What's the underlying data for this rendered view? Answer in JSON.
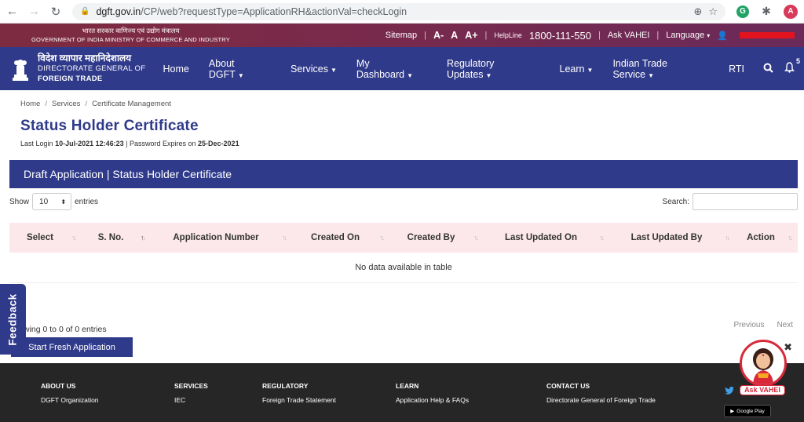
{
  "browser": {
    "url_host": "dgft.gov.in",
    "url_rest": "/CP/web?requestType=ApplicationRH&actionVal=checkLogin",
    "avatar_letter": "A",
    "ext_g_letter": "G"
  },
  "topbar": {
    "govt_hi": "भारत सरकार  वाणिज्य एवं उद्योग मंत्रालय",
    "govt_en": "GOVERNMENT OF INDIA   MINISTRY OF COMMERCE AND INDUSTRY",
    "sitemap": "Sitemap",
    "font_small": "A-",
    "font_normal": "A",
    "font_large": "A+",
    "helpline_label": "HelpLine",
    "phone": "1800-111-550",
    "ask_vahei": "Ask VAHEI",
    "language": "Language"
  },
  "logo": {
    "hi": "विदेश व्यापार महानिदेशालय",
    "line2": "DIRECTORATE GENERAL OF",
    "line3": "FOREIGN TRADE"
  },
  "nav": {
    "home": "Home",
    "about": "About DGFT",
    "services": "Services",
    "dashboard": "My Dashboard",
    "regulatory": "Regulatory Updates",
    "learn": "Learn",
    "trade_service": "Indian Trade Service",
    "rti": "RTI",
    "notif_count": "5"
  },
  "breadcrumb": [
    "Home",
    "Services",
    "Certificate Management"
  ],
  "page": {
    "title": "Status Holder Certificate",
    "last_login_label": "Last Login",
    "last_login_value": "10-Jul-2021 12:46:23",
    "pwd_label": "Password Expires on",
    "pwd_value": "25-Dec-2021"
  },
  "panel": {
    "heading": "Draft Application | Status Holder Certificate",
    "show_label": "Show",
    "entries_value": "10",
    "entries_label": "entries",
    "search_label": "Search:",
    "search_value": ""
  },
  "table": {
    "columns": [
      "Select",
      "S. No.",
      "Application Number",
      "Created On",
      "Created By",
      "Last Updated On",
      "Last Updated By",
      "Action"
    ],
    "empty_message": "No data available in table"
  },
  "pager": {
    "info": "wing 0 to 0 of 0 entries",
    "previous": "Previous",
    "next": "Next"
  },
  "actions": {
    "fresh": "Start Fresh Application",
    "feedback": "Feedback",
    "vahei": "Ask VAHEI"
  },
  "footer": {
    "about_h": "ABOUT US",
    "about_1": "DGFT Organization",
    "services_h": "SERVICES",
    "services_1": "IEC",
    "regulatory_h": "REGULATORY",
    "regulatory_1": "Foreign Trade Statement",
    "learn_h": "LEARN",
    "learn_1": "Application Help & FAQs",
    "contact_h": "CONTACT US",
    "contact_1": "Directorate General of Foreign Trade",
    "gplay": "Google Play"
  },
  "colors": {
    "primary": "#2f3a8a",
    "topbar": "#7a2a4a",
    "table_head": "#fce8ea",
    "accent_red": "#d8283a"
  }
}
